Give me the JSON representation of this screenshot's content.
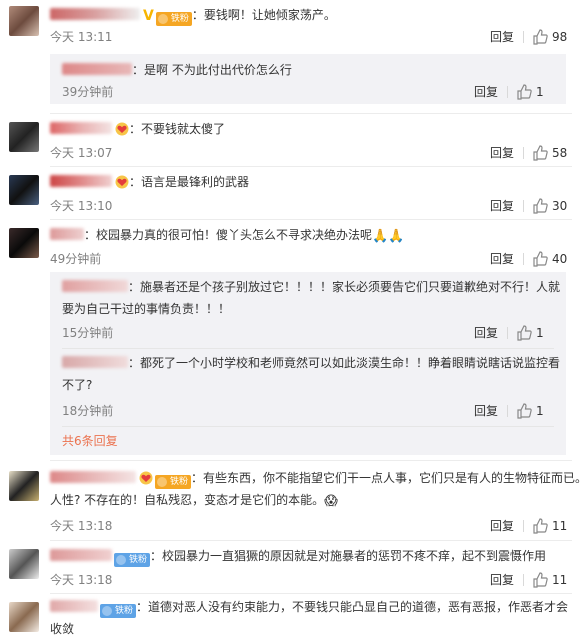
{
  "comments": [
    {
      "text": "：要钱啊！让她倾家荡产。",
      "badge": "铁粉",
      "vip": "V",
      "time": "今天 13:11",
      "reply": "回复",
      "likes": "98",
      "replies": [
        {
          "text": "：是啊 不为此付出代价怎么行",
          "time": "39分钟前",
          "reply": "回复",
          "likes": "1"
        }
      ]
    },
    {
      "text": "：不要钱就太傻了",
      "time": "今天 13:07",
      "reply": "回复",
      "likes": "58"
    },
    {
      "text": "：语言是最锋利的武器",
      "time": "今天 13:10",
      "reply": "回复",
      "likes": "30"
    },
    {
      "text": "：校园暴力真的很可怕！傻丫头怎么不寻求决绝办法呢",
      "emoji": "🙏🙏",
      "time": "49分钟前",
      "reply": "回复",
      "likes": "40",
      "replies": [
        {
          "line1": "：施暴者还是个孩子别放过它！！！！家长必须要告它们只要道歉绝对不行！人就",
          "line2": "要为自己干过的事情负责！！！",
          "time": "15分钟前",
          "reply": "回复",
          "likes": "1"
        },
        {
          "line1": "：都死了一个小时学校和老师竟然可以如此淡漠生命！！睁着眼睛说瞎话说监控看",
          "line2": "不了?",
          "time": "18分钟前",
          "reply": "回复",
          "likes": "1"
        }
      ],
      "more": "共6条回复"
    },
    {
      "line1": "：有些东西，你不能指望它们干一点人事，它们只是有人的生物特征而已。",
      "line2": "人性? 不存在的！自私残忍，变态才是它们的本能。",
      "emoji": "😱",
      "badge": "铁粉",
      "time": "今天 13:18",
      "reply": "回复",
      "likes": "11"
    },
    {
      "text": "：校园暴力一直猖獗的原因就是对施暴者的惩罚不疼不痒，起不到震慑作用",
      "badge": "铁粉",
      "time": "今天 13:18",
      "reply": "回复",
      "likes": "11"
    },
    {
      "line1": "：道德对恶人没有约束能力，不要钱只能凸显自己的道德，恶有恶报，作恶者才会",
      "line2": "收敛",
      "badge": "铁粉"
    }
  ],
  "colors": {
    "link": "#eb7350",
    "meta": "#808080",
    "subBg": "#f2f2f5",
    "badgeGold": "#f5a623",
    "badgeBlue": "#5ea3e6"
  },
  "icons": {
    "like": "thumbs-up-icon",
    "heart": "heart-badge-icon",
    "vip": "vip-v-icon"
  }
}
